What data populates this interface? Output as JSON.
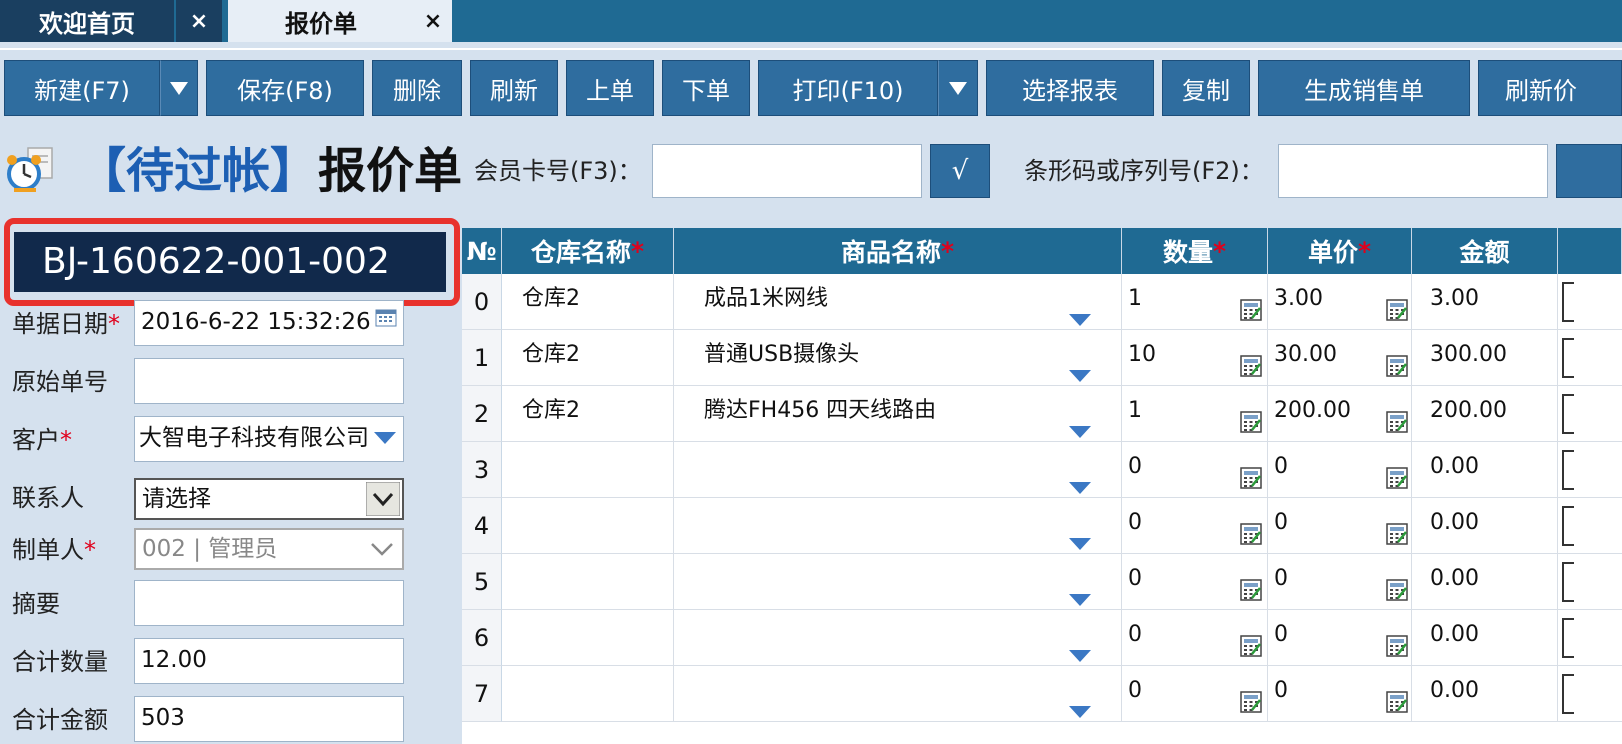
{
  "tabs": [
    {
      "label": "欢迎首页",
      "close": "×"
    },
    {
      "label": "报价单",
      "close": "×"
    }
  ],
  "toolbar": {
    "new": "新建(F7)",
    "save": "保存(F8)",
    "delete": "删除",
    "refresh": "刷新",
    "prev": "上单",
    "next": "下单",
    "print": "打印(F10)",
    "select_report": "选择报表",
    "copy": "复制",
    "gen_sales": "生成销售单",
    "refresh_price": "刷新价"
  },
  "title": {
    "status": "【待过帐】",
    "name": "报价单"
  },
  "member_card": {
    "label": "会员卡号(F3)：",
    "value": "",
    "check": "√"
  },
  "barcode": {
    "label": "条形码或序列号(F2)：",
    "value": ""
  },
  "doc_number": "BJ-160622-001-002",
  "form": {
    "date_label": "单据日期",
    "date_value": "2016-6-22 15:32:26",
    "orig_label": "原始单号",
    "orig_value": "",
    "customer_label": "客户",
    "customer_value": "大智电子科技有限公司",
    "contact_label": "联系人",
    "contact_value": "请选择",
    "maker_label": "制单人",
    "maker_value": "002 | 管理员",
    "summary_label": "摘要",
    "summary_value": "",
    "total_qty_label": "合计数量",
    "total_qty_value": "12.00",
    "total_amt_label": "合计金额",
    "total_amt_value": "503"
  },
  "required_mark": "*",
  "grid": {
    "headers": {
      "no": "№",
      "warehouse": "仓库名称",
      "product": "商品名称",
      "qty": "数量",
      "price": "单价",
      "amount": "金额"
    },
    "rows": [
      {
        "no": "0",
        "warehouse": "仓库2",
        "product": "成品1米网线",
        "qty": "1",
        "price": "3.00",
        "amount": "3.00"
      },
      {
        "no": "1",
        "warehouse": "仓库2",
        "product": "普通USB摄像头",
        "qty": "10",
        "price": "30.00",
        "amount": "300.00"
      },
      {
        "no": "2",
        "warehouse": "仓库2",
        "product": "腾达FH456 四天线路由",
        "qty": "1",
        "price": "200.00",
        "amount": "200.00"
      },
      {
        "no": "3",
        "warehouse": "",
        "product": "",
        "qty": "0",
        "price": "0",
        "amount": "0.00"
      },
      {
        "no": "4",
        "warehouse": "",
        "product": "",
        "qty": "0",
        "price": "0",
        "amount": "0.00"
      },
      {
        "no": "5",
        "warehouse": "",
        "product": "",
        "qty": "0",
        "price": "0",
        "amount": "0.00"
      },
      {
        "no": "6",
        "warehouse": "",
        "product": "",
        "qty": "0",
        "price": "0",
        "amount": "0.00"
      },
      {
        "no": "7",
        "warehouse": "",
        "product": "",
        "qty": "0",
        "price": "0",
        "amount": "0.00"
      }
    ]
  },
  "colors": {
    "accent": "#1f6a93",
    "button": "#2f6d9f",
    "highlight": "#e8322d",
    "required": "#e0001b"
  }
}
